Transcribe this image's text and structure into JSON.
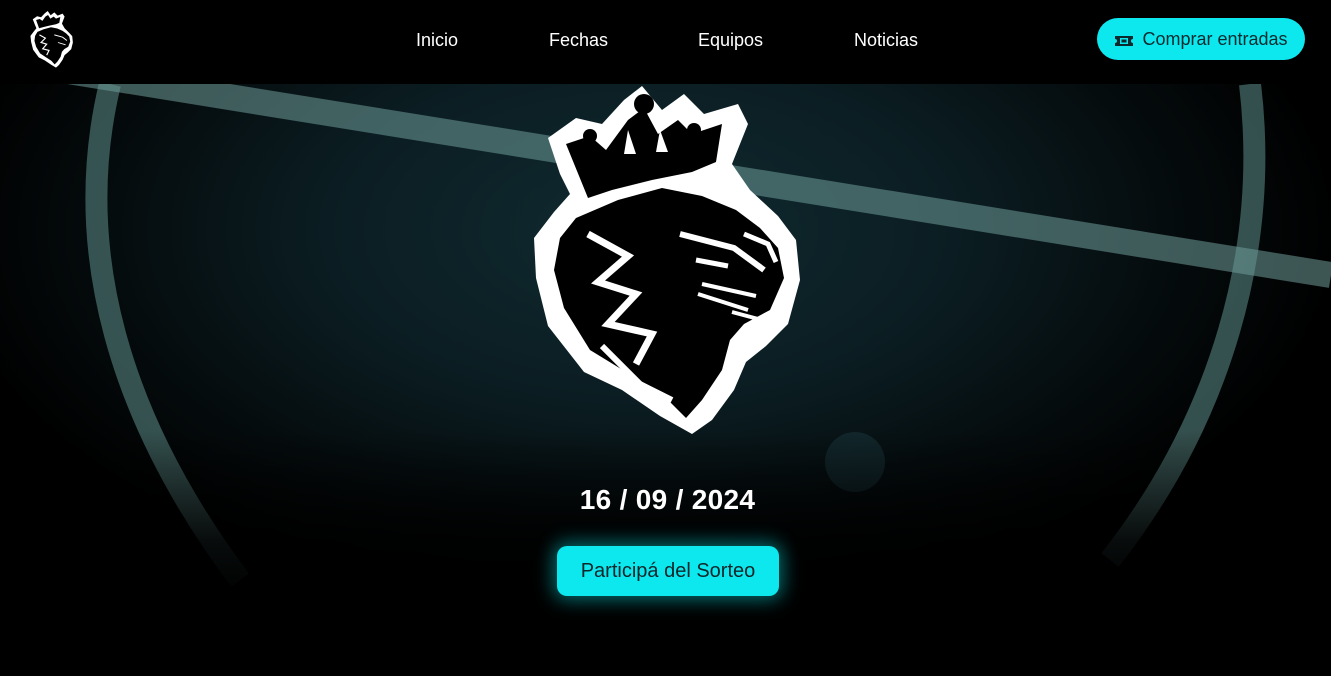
{
  "navbar": {
    "logo_icon": "crowned-lion-logo-icon",
    "links": [
      {
        "label": "Inicio"
      },
      {
        "label": "Fechas"
      },
      {
        "label": "Equipos"
      },
      {
        "label": "Noticias"
      }
    ],
    "buy_button": {
      "label": "Comprar entradas",
      "icon": "ticket-icon"
    }
  },
  "hero": {
    "logo_icon": "crowned-lion-logo-icon",
    "date": "16 / 09 / 2024",
    "cta_label": "Participá del Sorteo",
    "background": "basketball-court-lines"
  },
  "colors": {
    "accent": "#0ce8ee",
    "background": "#000000",
    "text": "#ffffff",
    "button_text": "#0e2629"
  }
}
